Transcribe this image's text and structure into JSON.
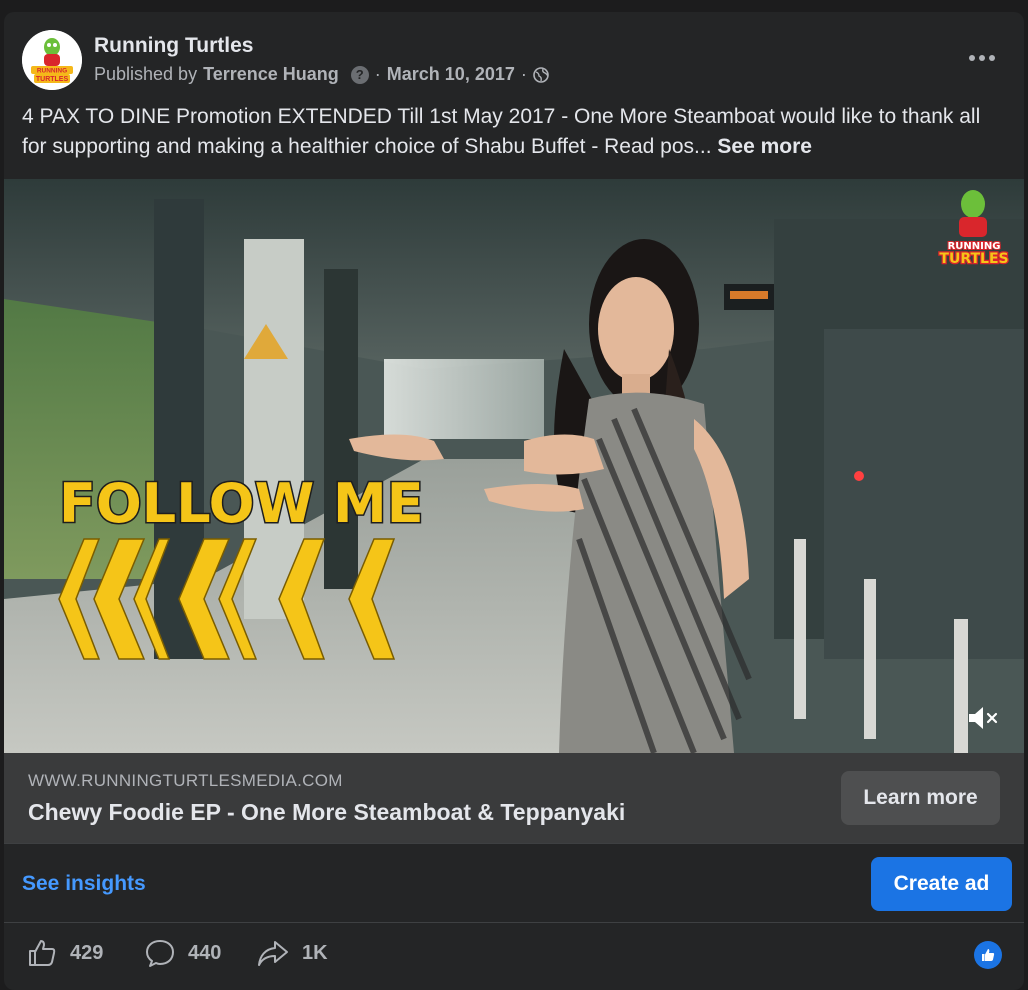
{
  "post": {
    "page_name": "Running Turtles",
    "published_by_label": "Published by",
    "author": "Terrence Huang",
    "help_glyph": "?",
    "separator": "·",
    "date": "March 10, 2017",
    "audience_icon": "globe-icon",
    "more_icon": "more-dots-icon",
    "caption": "4 PAX TO DINE Promotion EXTENDED Till 1st May 2017 - One More Steamboat would like to thank all for supporting and making a healthier choice of Shabu Buffet - Read pos...",
    "see_more_label": "See more"
  },
  "video": {
    "overlay_text": "FOLLOW ME",
    "watermark_text": [
      "RUNNING",
      "TURTLES"
    ],
    "mute_icon": "muted-speaker-icon"
  },
  "avatar": {
    "logo_text": [
      "RUNNING",
      "TURTLES"
    ]
  },
  "link_preview": {
    "domain": "WWW.RUNNINGTURTLESMEDIA.COM",
    "title": "Chewy Foodie EP - One More Steamboat & Teppanyaki",
    "cta_label": "Learn more"
  },
  "insights": {
    "see_insights_label": "See insights",
    "create_ad_label": "Create ad"
  },
  "engagement": {
    "likes": "429",
    "comments": "440",
    "shares": "1K",
    "like_icon": "thumbs-up-icon",
    "comment_icon": "comment-bubble-icon",
    "share_icon": "share-arrow-icon",
    "reaction_icon": "like-reaction-icon"
  },
  "colors": {
    "card_bg": "#242526",
    "link_box_bg": "#3a3b3c",
    "accent_blue": "#1b74e4",
    "link_blue": "#4599ff",
    "overlay_yellow": "#f5c518"
  }
}
